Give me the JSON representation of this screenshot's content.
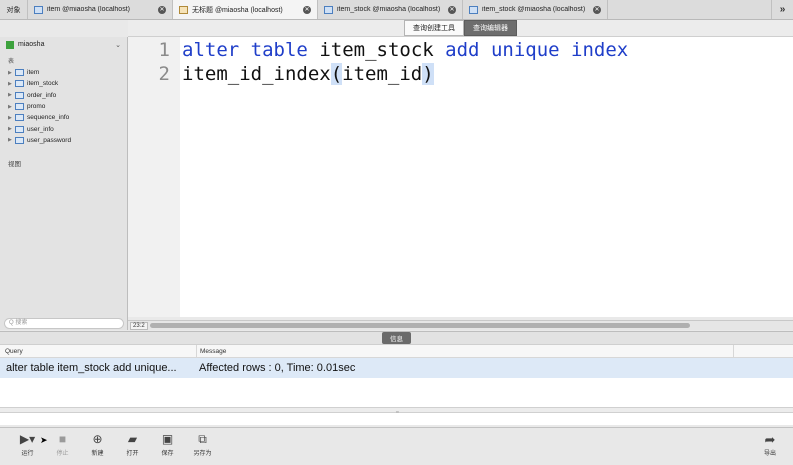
{
  "tabs": {
    "objects_label": "对象",
    "items": [
      {
        "label": "item @miaosha (localhost)",
        "icon": "table-icon"
      },
      {
        "label": "无标题 @miaosha (localhost)",
        "icon": "query-icon"
      },
      {
        "label": "item_stock @miaosha (localhost)",
        "icon": "table-icon"
      },
      {
        "label": "item_stock @miaosha (localhost)",
        "icon": "table-icon"
      }
    ],
    "more": "»"
  },
  "modes": {
    "builder": "查询创建工具",
    "editor": "查询编辑器"
  },
  "sidebar": {
    "database": "miaosha",
    "tables_label": "表",
    "tables": [
      "item",
      "item_stock",
      "order_info",
      "promo",
      "sequence_info",
      "user_info",
      "user_password"
    ],
    "views_label": "视图",
    "search_placeholder": "Q 搜索"
  },
  "editor": {
    "lines": [
      {
        "no": "1",
        "text": "alter table item_stock add unique index"
      },
      {
        "no": "2",
        "text": "item_id_index(item_id)"
      }
    ],
    "cursor_pos": "23:2"
  },
  "info": {
    "tab_label": "信息"
  },
  "results": {
    "columns": [
      "Query",
      "Message"
    ],
    "rows": [
      {
        "query": "alter table item_stock add unique...",
        "message": "Affected rows : 0, Time: 0.01sec"
      }
    ]
  },
  "toolbar": {
    "run": "运行",
    "stop": "停止",
    "new": "新建",
    "open": "打开",
    "save": "保存",
    "save_as": "另存为",
    "export": "导出"
  }
}
